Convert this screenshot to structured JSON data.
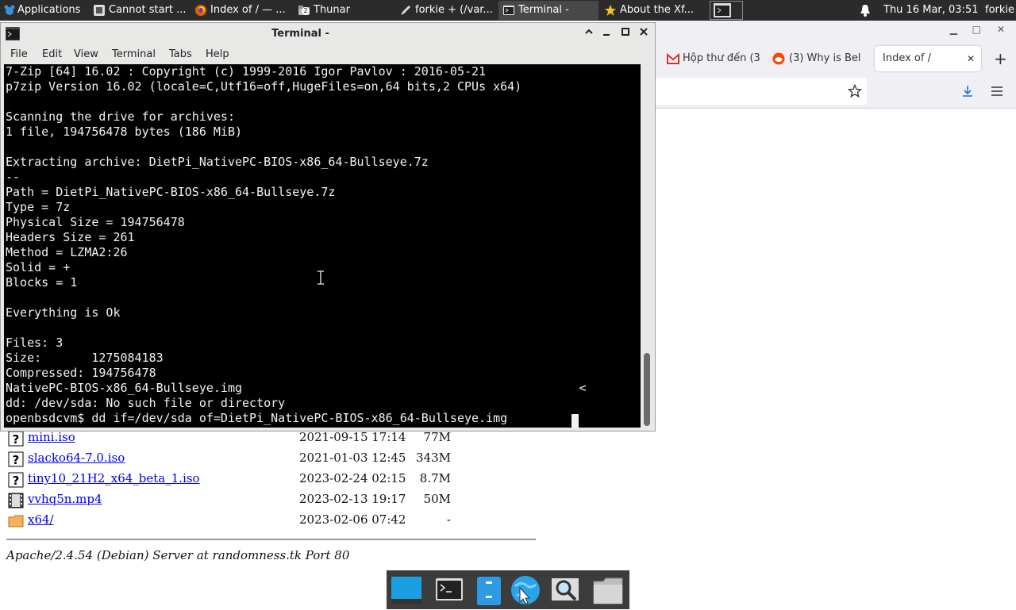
{
  "top_panel": {
    "applications_label": "Applications",
    "tasks": [
      {
        "label": "Cannot start ...",
        "icon": "document-icon"
      },
      {
        "label": "Index of / — ...",
        "icon": "firefox-icon"
      },
      {
        "label": "Thunar",
        "icon": "folder-icon",
        "badge": "2"
      },
      {
        "label": "forkie + (/var...",
        "icon": "editor-icon"
      },
      {
        "label": "Terminal -",
        "icon": "terminal-icon"
      },
      {
        "label": "About the Xf...",
        "icon": "star-icon"
      }
    ],
    "clock": "Thu 16 Mar, 03:51",
    "user": "forkie"
  },
  "browser": {
    "tabs": [
      {
        "label": "Hộp thư đến (3",
        "icon": "gmail-icon"
      },
      {
        "label": "(3) Why is Bel",
        "icon": "reddit-icon"
      },
      {
        "label": "Index of /",
        "active": true
      }
    ],
    "close_tab_glyph": "✕",
    "new_tab_glyph": "+"
  },
  "listing": [
    {
      "name": "mini.iso",
      "date": "2021-09-15 17:14",
      "size": "77M",
      "icon": "unknown-file-icon"
    },
    {
      "name": "slacko64-7.0.iso",
      "date": "2021-01-03 12:45",
      "size": "343M",
      "icon": "unknown-file-icon"
    },
    {
      "name": "tiny10_21H2_x64_beta_1.iso",
      "date": "2023-02-24 02:15",
      "size": "8.7M",
      "icon": "unknown-file-icon"
    },
    {
      "name": "vvhq5n.mp4",
      "date": "2023-02-13 19:17",
      "size": "50M",
      "icon": "video-file-icon"
    },
    {
      "name": "x64/",
      "date": "2023-02-06 07:42",
      "size": "-",
      "icon": "folder-icon"
    }
  ],
  "server_signature": "Apache/2.4.54 (Debian) Server at randomness.tk Port 80",
  "terminal": {
    "title": "Terminal -",
    "menu": [
      "File",
      "Edit",
      "View",
      "Terminal",
      "Tabs",
      "Help"
    ],
    "lines": [
      "7-Zip [64] 16.02 : Copyright (c) 1999-2016 Igor Pavlov : 2016-05-21",
      "p7zip Version 16.02 (locale=C,Utf16=off,HugeFiles=on,64 bits,2 CPUs x64)",
      "",
      "Scanning the drive for archives:",
      "1 file, 194756478 bytes (186 MiB)",
      "",
      "Extracting archive: DietPi_NativePC-BIOS-x86_64-Bullseye.7z",
      "--",
      "Path = DietPi_NativePC-BIOS-x86_64-Bullseye.7z",
      "Type = 7z",
      "Physical Size = 194756478",
      "Headers Size = 261",
      "Method = LZMA2:26",
      "Solid = +",
      "Blocks = 1",
      "",
      "Everything is Ok",
      "",
      "Files: 3",
      "Size:       1275084183",
      "Compressed: 194756478",
      "NativePC-BIOS-x86_64-Bullseye.img                                               <",
      "dd: /dev/sda: No such file or directory",
      "openbsdcvm$ dd if=/dev/sda of=DietPi_NativePC-BIOS-x86_64-Bullseye.img"
    ]
  },
  "dock": [
    "desktop-icon",
    "terminal-icon",
    "files-icon",
    "browser-icon",
    "search-icon",
    "folder-icon"
  ]
}
